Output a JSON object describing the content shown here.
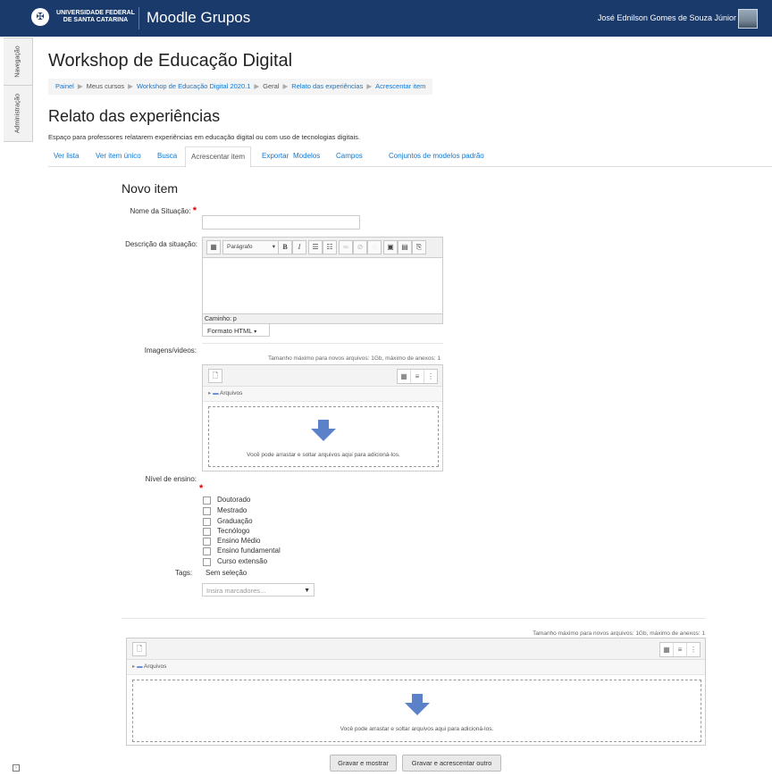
{
  "header": {
    "university": "UNIVERSIDADE FEDERAL DE SANTA CATARINA",
    "brand": "Moodle Grupos",
    "user_name": "José Ednilson Gomes de Souza Júnior"
  },
  "drawer": {
    "navigation": "Navegação",
    "administration": "Administração"
  },
  "course_title": "Workshop de Educação Digital",
  "breadcrumb": [
    "Painel",
    "Meus cursos",
    "Workshop de Educação Digital 2020.1",
    "Geral",
    "Relato das experiências",
    "Acrescentar item"
  ],
  "activity_title": "Relato das experiências",
  "intro": "Espaço para professores relatarem experiências em educação digital ou com uso de tecnologias digitais.",
  "tabs": [
    "Ver lista",
    "Ver item único",
    "Busca",
    "Acrescentar item",
    "Exportar",
    "Modelos",
    "Campos",
    "Conjuntos de modelos padrão"
  ],
  "active_tab": "Acrescentar item",
  "form": {
    "legend": "Novo item",
    "nome_label": "Nome da Situação:",
    "nome_value": "",
    "descricao_label": "Descrição da situação:",
    "paragraph_select": "Parágrafo",
    "path": "Caminho: p",
    "format": "Formato HTML",
    "imagens_label": "Imagens/videos:",
    "file_info": "Tamanho máximo para novos arquivos: 1Gb, máximo de anexos: 1",
    "folder": "Arquivos",
    "drop_msg": "Você pode arrastar e soltar arquivos aqui para adicioná-los.",
    "nivel_label": "Nível de ensino:",
    "nivel_options": [
      "Doutorado",
      "Mestrado",
      "Graduação",
      "Tecnólogo",
      "Ensino Médio",
      "Ensino fundamental",
      "Curso extensão"
    ],
    "tags_label": "Tags:",
    "tags_value": "Sem seleção",
    "tags_placeholder": "Insira marcadores...",
    "save_view": "Gravar e mostrar",
    "save_add": "Gravar e acrescentar outro"
  },
  "colors": {
    "navbar": "#1a3a6b",
    "link": "#1177d1",
    "required": "#dd0000",
    "drop_arrow": "#5b82c8"
  }
}
